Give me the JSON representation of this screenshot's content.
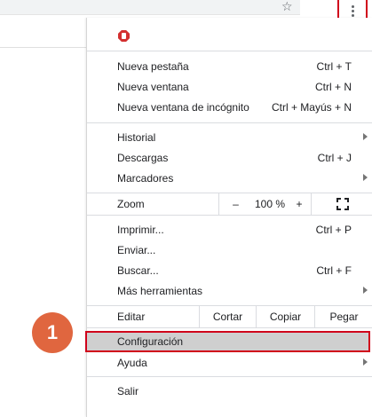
{
  "menu": {
    "new_tab": {
      "label": "Nueva pestaña",
      "shortcut": "Ctrl + T"
    },
    "new_window": {
      "label": "Nueva ventana",
      "shortcut": "Ctrl + N"
    },
    "incognito": {
      "label": "Nueva ventana de incógnito",
      "shortcut": "Ctrl + Mayús + N"
    },
    "history": {
      "label": "Historial"
    },
    "downloads": {
      "label": "Descargas",
      "shortcut": "Ctrl + J"
    },
    "bookmarks": {
      "label": "Marcadores"
    },
    "zoom": {
      "label": "Zoom",
      "minus": "–",
      "value": "100 %",
      "plus": "+"
    },
    "print": {
      "label": "Imprimir...",
      "shortcut": "Ctrl + P"
    },
    "cast": {
      "label": "Enviar..."
    },
    "find": {
      "label": "Buscar...",
      "shortcut": "Ctrl + F"
    },
    "more_tools": {
      "label": "Más herramientas"
    },
    "edit": {
      "label": "Editar",
      "cut": "Cortar",
      "copy": "Copiar",
      "paste": "Pegar"
    },
    "settings": {
      "label": "Configuración"
    },
    "help": {
      "label": "Ayuda"
    },
    "exit": {
      "label": "Salir"
    }
  },
  "step_badge": "1",
  "colors": {
    "highlight_border": "#d0021b",
    "badge": "#e0663f",
    "selected_bg": "#cfcfcf"
  }
}
